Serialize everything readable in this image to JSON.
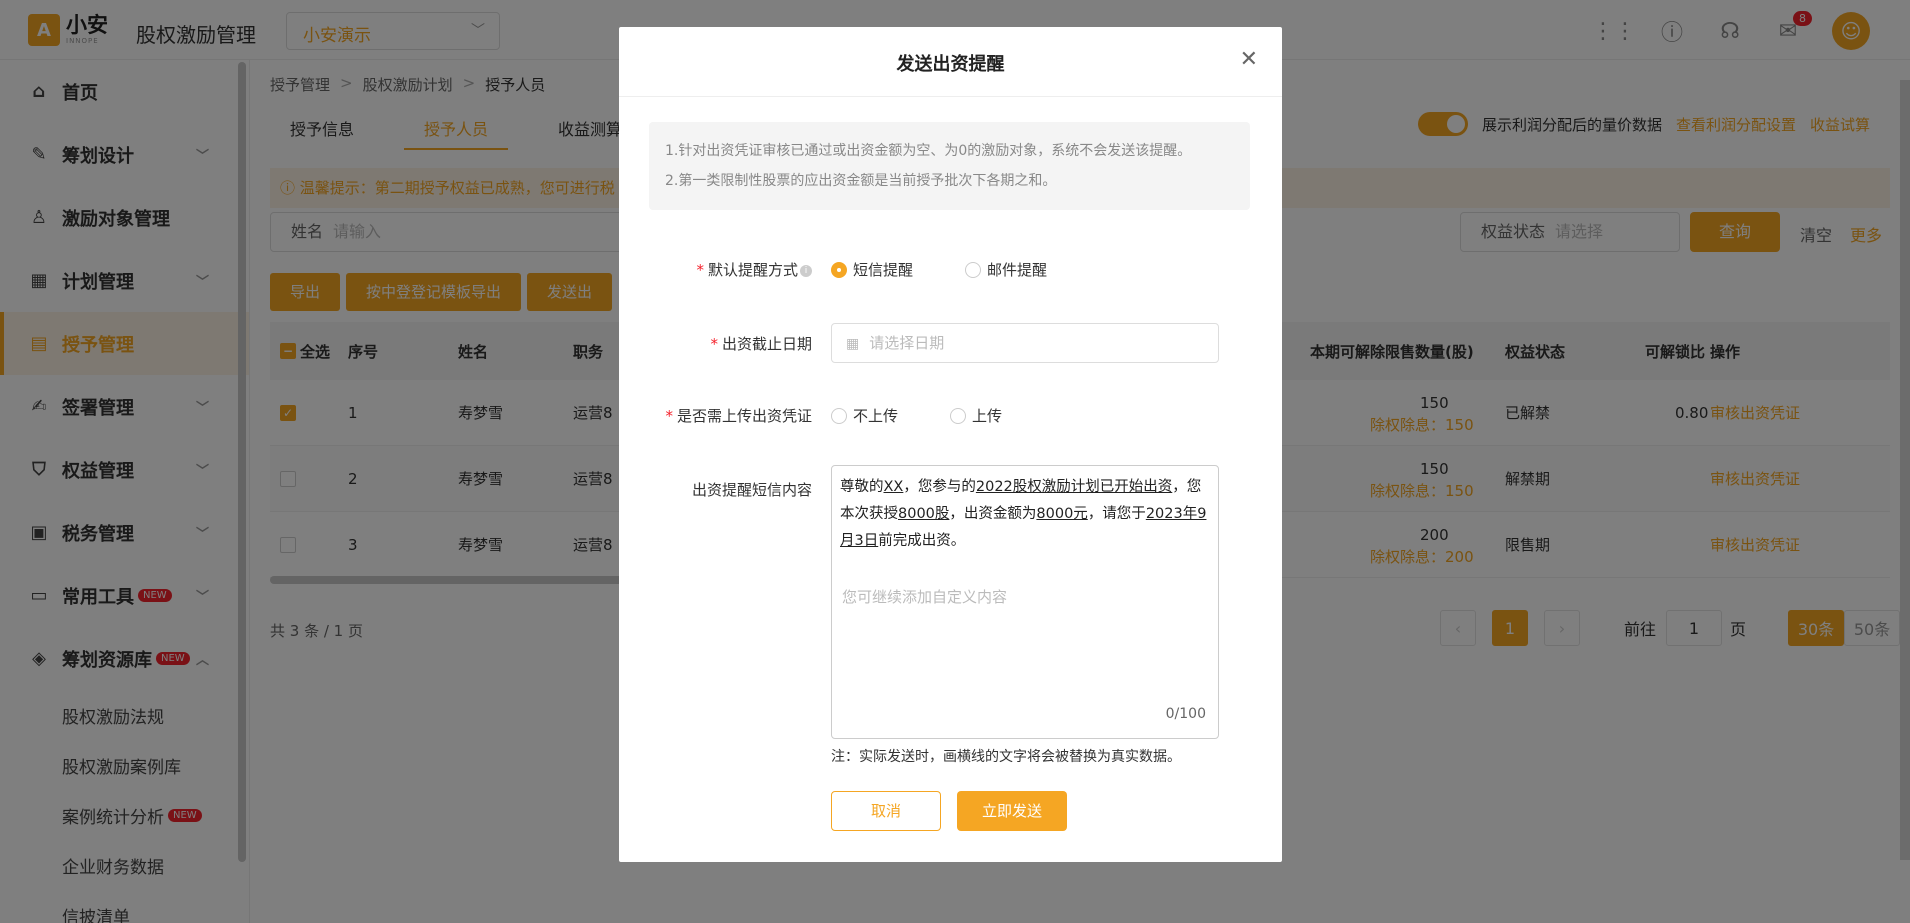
{
  "app": {
    "logo_char": "小安",
    "logo_brand": "小安",
    "logo_sub": "INNOPE",
    "title": "股权激励管理",
    "org": "小安演示",
    "notification_count": "8"
  },
  "sidebar": {
    "items": [
      {
        "label": "首页",
        "icon": "home-icon"
      },
      {
        "label": "筹划设计",
        "icon": "edit-icon"
      },
      {
        "label": "激励对象管理",
        "icon": "user-icon"
      },
      {
        "label": "计划管理",
        "icon": "grid-icon"
      },
      {
        "label": "授予管理",
        "icon": "document-icon"
      },
      {
        "label": "签署管理",
        "icon": "sign-icon"
      },
      {
        "label": "权益管理",
        "icon": "shield-icon"
      },
      {
        "label": "税务管理",
        "icon": "tax-icon"
      },
      {
        "label": "常用工具",
        "icon": "toolbox-icon",
        "badge": "NEW"
      },
      {
        "label": "筹划资源库",
        "icon": "layers-icon",
        "badge": "NEW"
      }
    ],
    "sub_items": [
      {
        "label": "股权激励法规"
      },
      {
        "label": "股权激励案例库"
      },
      {
        "label": "案例统计分析",
        "badge": "NEW"
      },
      {
        "label": "企业财务数据"
      },
      {
        "label": "信披清单"
      }
    ]
  },
  "main": {
    "breadcrumb": [
      "授予管理",
      "股权激励计划",
      "授予人员"
    ],
    "tabs": [
      "授予信息",
      "授予人员",
      "收益测算"
    ],
    "toggle_label": "展示利润分配后的量价数据",
    "link_profit": "查看利润分配设置",
    "link_calc": "收益试算",
    "notice": "ⓘ 温馨提示：第二期授予权益已成熟，您可进行税",
    "filter_name_label": "姓名",
    "filter_name_placeholder": "请输入",
    "filter_status_label": "权益状态",
    "filter_status_placeholder": "请选择",
    "btn_query": "查询",
    "btn_clear": "清空",
    "btn_more": "更多",
    "action_buttons": [
      "导出",
      "按中登登记模板导出",
      "发送出"
    ],
    "table_headers": {
      "select_all": "全选",
      "index": "序号",
      "name": "姓名",
      "position": "职务",
      "unlockable": "本期可解除限售数量(股)",
      "status": "权益状态",
      "ratio": "可解锁比",
      "operation": "操作"
    },
    "rows": [
      {
        "index": "1",
        "name": "寿梦雪",
        "position": "运营8",
        "unlockable": "150",
        "ex_label": "除权除息：150",
        "status": "已解禁",
        "ratio": "0.80",
        "op": "审核出资凭证"
      },
      {
        "index": "2",
        "name": "寿梦雪",
        "position": "运营8",
        "unlockable": "150",
        "ex_label": "除权除息：150",
        "status": "解禁期",
        "ratio": "",
        "op": "审核出资凭证"
      },
      {
        "index": "3",
        "name": "寿梦雪",
        "position": "运营8",
        "unlockable": "200",
        "ex_label": "除权除息：200",
        "status": "限售期",
        "ratio": "",
        "op": "审核出资凭证"
      }
    ],
    "total": "共 3 条 / 1 页",
    "page_current": "1",
    "goto_label": "前往",
    "goto_value": "1",
    "page_unit": "页",
    "size_30": "30条",
    "size_50": "50条"
  },
  "modal": {
    "title": "发送出资提醒",
    "tip1": "1.针对出资凭证审核已通过或出资金额为空、为0的激励对象，系统不会发送该提醒。",
    "tip2": "2.第一类限制性股票的应出资金额是当前授予批次下各期之和。",
    "method_label": "默认提醒方式",
    "method_sms": "短信提醒",
    "method_email": "邮件提醒",
    "deadline_label": "出资截止日期",
    "deadline_placeholder": "请选择日期",
    "upload_label": "是否需上传出资凭证",
    "upload_no": "不上传",
    "upload_yes": "上传",
    "sms_label": "出资提醒短信内容",
    "sms_parts": {
      "p1": "尊敬的",
      "v1": "XX",
      "p2": "，您参与的",
      "v2": "2022股权激励计划已开始出资",
      "p3": "，您本次获授",
      "v3": "8000股",
      "p4": "，出资金额为",
      "v4": "8000元",
      "p5": "，请您于",
      "v5": "2023年9月3日",
      "p6": "前完成出资。"
    },
    "sms_placeholder": "您可继续添加自定义内容",
    "sms_count": "0/100",
    "note": "注：实际发送时，画横线的文字将会被替换为真实数据。",
    "btn_cancel": "取消",
    "btn_send": "立即发送"
  },
  "colors": {
    "accent": "#f5a623",
    "danger": "#f5222d"
  }
}
